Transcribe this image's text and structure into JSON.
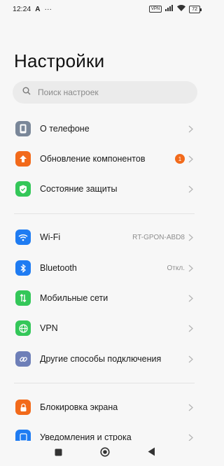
{
  "status": {
    "time": "12:24",
    "extra": "···",
    "vpn": "VPN",
    "battery": "72"
  },
  "title": "Настройки",
  "search": {
    "placeholder": "Поиск настроек"
  },
  "group1": [
    {
      "label": "О телефоне",
      "icon": "phone-info-icon",
      "color": "#7a8799"
    },
    {
      "label": "Обновление компонентов",
      "icon": "update-arrow-icon",
      "color": "#f26a1b",
      "badge": "1"
    },
    {
      "label": "Состояние защиты",
      "icon": "shield-check-icon",
      "color": "#34c759"
    }
  ],
  "group2": [
    {
      "label": "Wi-Fi",
      "icon": "wifi-icon",
      "color": "#1f7cf2",
      "value": "RT-GPON-ABD8"
    },
    {
      "label": "Bluetooth",
      "icon": "bluetooth-icon",
      "color": "#1f7cf2",
      "value": "Откл."
    },
    {
      "label": "Мобильные сети",
      "icon": "mobile-network-icon",
      "color": "#34c759"
    },
    {
      "label": "VPN",
      "icon": "vpn-globe-icon",
      "color": "#34c759"
    },
    {
      "label": "Другие способы подключения",
      "icon": "link-icon",
      "color": "#6e7fb8"
    }
  ],
  "group3": [
    {
      "label": "Блокировка экрана",
      "icon": "lock-icon",
      "color": "#f26a1b"
    },
    {
      "label": "Уведомления и строка",
      "icon": "notifications-icon",
      "color": "#1f7cf2"
    }
  ]
}
